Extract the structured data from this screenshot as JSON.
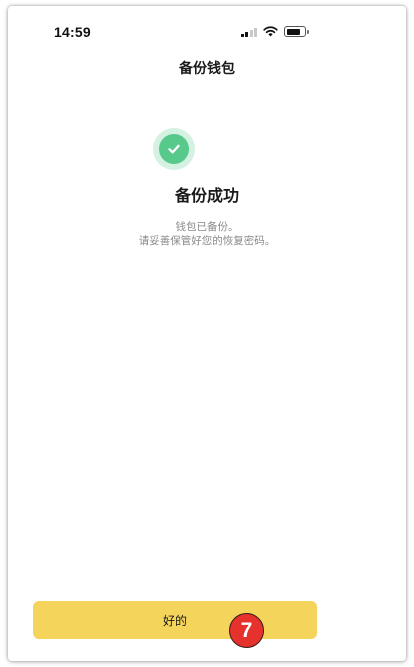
{
  "status_bar": {
    "time": "14:59",
    "icons": [
      "cellular-signal-icon",
      "wifi-icon",
      "battery-icon"
    ]
  },
  "nav": {
    "title": "备份钱包"
  },
  "result": {
    "icon": "check-circle-icon",
    "title": "备份成功",
    "message_line1": "钱包已备份。",
    "message_line2": "请妥善保管好您的恢复密码。"
  },
  "actions": {
    "ok_label": "好的"
  },
  "annotation": {
    "step_number": "7"
  },
  "colors": {
    "accent_button": "#f5d45b",
    "success_green": "#56c98b",
    "success_halo": "#d4f1e1",
    "step_badge": "#e5322d"
  }
}
